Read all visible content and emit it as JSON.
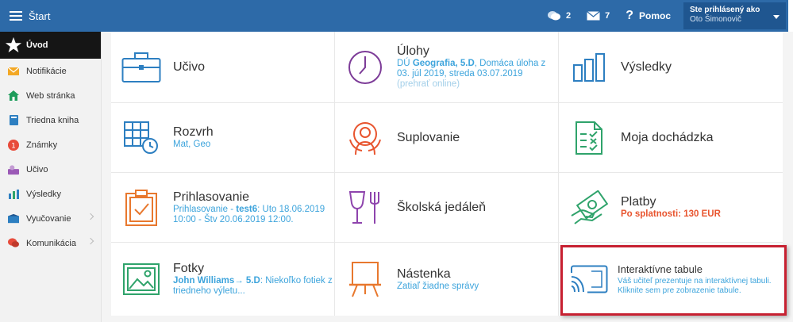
{
  "header": {
    "title": "Štart",
    "messages_count": "2",
    "mail_count": "7",
    "help_label": "Pomoc",
    "user_label": "Ste prihlásený ako",
    "user_name": "Oto Šimonovič"
  },
  "sidebar": {
    "items": [
      {
        "label": "Úvod",
        "icon": "star-icon"
      },
      {
        "label": "Notifikácie",
        "icon": "envelope-icon"
      },
      {
        "label": "Web stránka",
        "icon": "house-icon"
      },
      {
        "label": "Triedna kniha",
        "icon": "book-icon"
      },
      {
        "label": "Známky",
        "icon": "grade-icon"
      },
      {
        "label": "Učivo",
        "icon": "lesson-icon"
      },
      {
        "label": "Výsledky",
        "icon": "bars-icon"
      },
      {
        "label": "Vyučovanie",
        "icon": "teaching-icon"
      },
      {
        "label": "Komunikácia",
        "icon": "chat-icon"
      }
    ]
  },
  "tiles": {
    "ucivo": {
      "title": "Učivo"
    },
    "ulohy": {
      "title": "Úlohy",
      "prefix": "DÚ ",
      "subject": "Geografia",
      "class_name": ", 5.D",
      "desc": ", Domáca úloha z 03. júl 2019, streda 03.07.2019",
      "link": "(prehrať online)"
    },
    "vysledky": {
      "title": "Výsledky"
    },
    "rozvrh": {
      "title": "Rozvrh",
      "subtitle": "Mat, Geo"
    },
    "suplovanie": {
      "title": "Suplovanie"
    },
    "dochadzka": {
      "title": "Moja dochádzka"
    },
    "prihlasovanie": {
      "title": "Prihlasovanie",
      "prefix": "Prihlasovanie - ",
      "name": "test6",
      "desc": ": Uto 18.06.2019 10:00 - Štv 20.06.2019 12:00."
    },
    "jedalen": {
      "title": "Školská jedáleň"
    },
    "platby": {
      "title": "Platby",
      "subtitle": "Po splatnosti: 130 EUR"
    },
    "fotky": {
      "title": "Fotky",
      "author": "John Williams",
      "arrow_class": "→ 5.D",
      "desc": ": Niekoľko fotiek z triedneho výletu..."
    },
    "nastenka": {
      "title": "Nástenka",
      "subtitle": "Zatiaľ žiadne správy"
    },
    "tabule": {
      "title": "Interaktívne tabule",
      "line1": "Váš učiteľ prezentuje na interaktívnej tabuli.",
      "line2": "Kliknite sem pre zobrazenie tabule."
    }
  },
  "colors": {
    "header_bg": "#2d6aa8",
    "accent_orange": "#e8782e",
    "accent_blue": "#2d7fc1",
    "accent_red": "#e8542e",
    "accent_purple": "#8e44ad",
    "accent_green": "#2fa36b",
    "highlight_border": "#c72031"
  }
}
